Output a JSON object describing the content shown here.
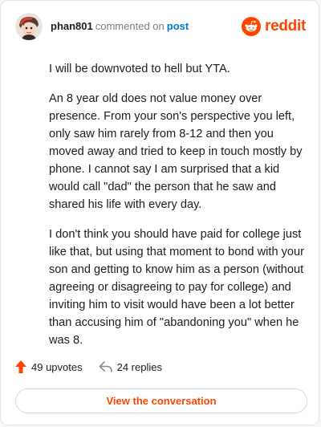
{
  "header": {
    "username": "phan801",
    "action_text": "commented on",
    "post_link": "post",
    "brand_name": "reddit",
    "brand_color": "#ff4500",
    "post_link_color": "#0079d3"
  },
  "comment": {
    "paragraphs": [
      "I will be downvoted to hell but YTA.",
      "An 8 year old does not value money over presence. From your son's perspective you left, only saw him rarely from 8-12 and then you moved away and tried to keep in touch mostly by phone. I cannot say I am surprised that a kid would call \"dad\" the person that he saw and shared his life with every day.",
      "I don't think you should have paid for college just like that, but using that moment to bond with your son and getting to know him as a person (without agreeing or disagreeing to pay for college) and inviting him to visit would have been a lot better than accusing him of \"abandoning you\" when he was 8."
    ]
  },
  "footer": {
    "upvotes": "49 upvotes",
    "replies": "24 replies",
    "upvote_icon": "upvote-arrow-icon",
    "reply_icon": "reply-arrow-icon"
  },
  "cta": {
    "label": "View the conversation"
  }
}
